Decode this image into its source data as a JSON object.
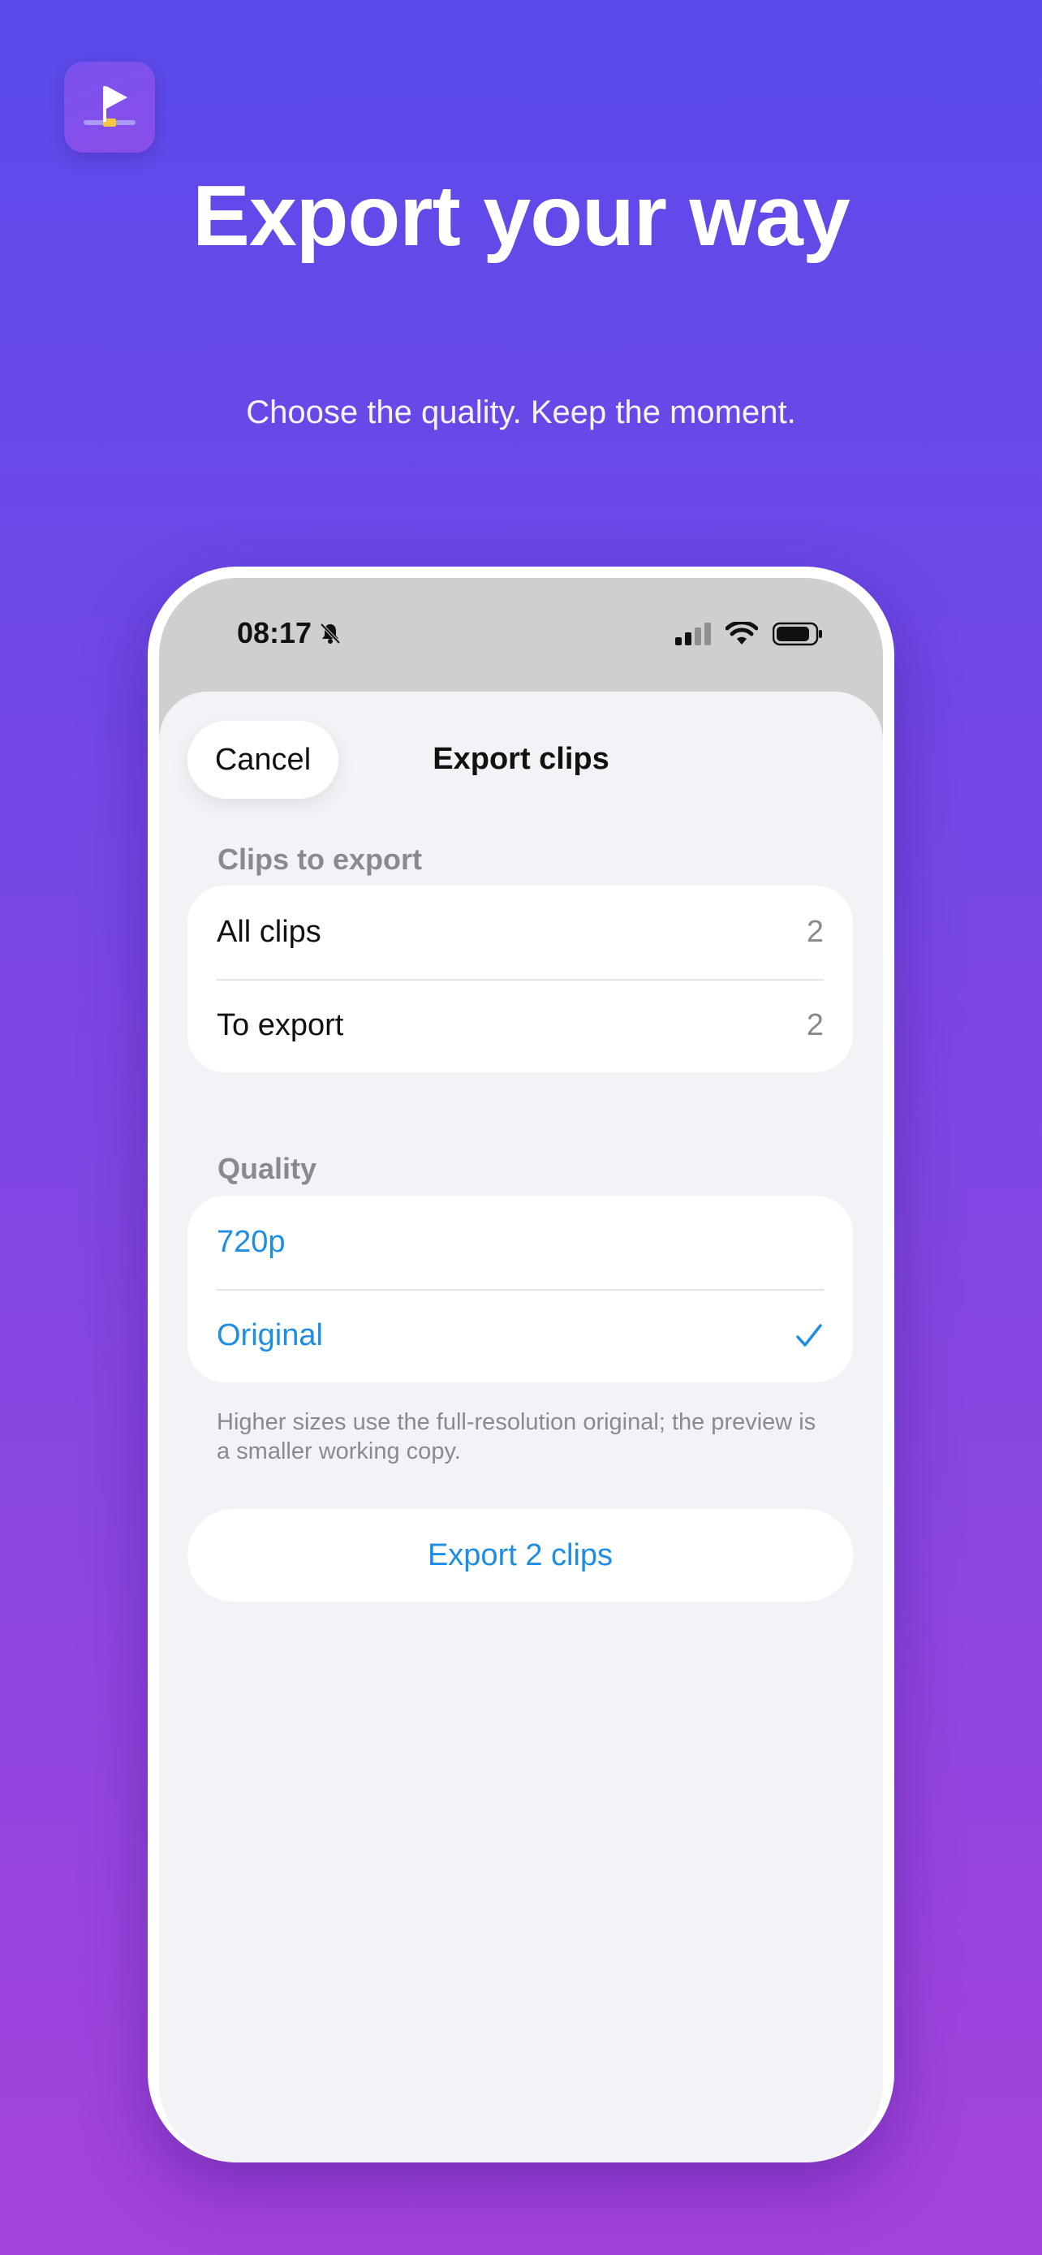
{
  "hero": {
    "title": "Export your way",
    "subtitle": "Choose the quality. Keep the moment."
  },
  "status_bar": {
    "time": "08:17"
  },
  "sheet": {
    "cancel_label": "Cancel",
    "title": "Export clips",
    "clips_section": {
      "header": "Clips to export",
      "rows": [
        {
          "label": "All clips",
          "value": "2"
        },
        {
          "label": "To export",
          "value": "2"
        }
      ]
    },
    "quality_section": {
      "header": "Quality",
      "options": [
        {
          "label": "720p",
          "selected": false
        },
        {
          "label": "Original",
          "selected": true
        }
      ],
      "checkmark": "✓",
      "footnote": "Higher sizes use the full-resolution original; the preview is a smaller working copy."
    },
    "export_label": "Export 2 clips"
  },
  "colors": {
    "background_top": "#5a4bea",
    "background_bottom": "#a443dc",
    "accent": "#1c8ee3",
    "sheet_background": "#f2f2f7",
    "secondary_text": "#8a8a8e"
  },
  "icons": {
    "app_icon": "flag-timeline-icon",
    "status": [
      "bell-slash-icon",
      "cellular-signal-icon",
      "wifi-icon",
      "battery-icon"
    ]
  }
}
